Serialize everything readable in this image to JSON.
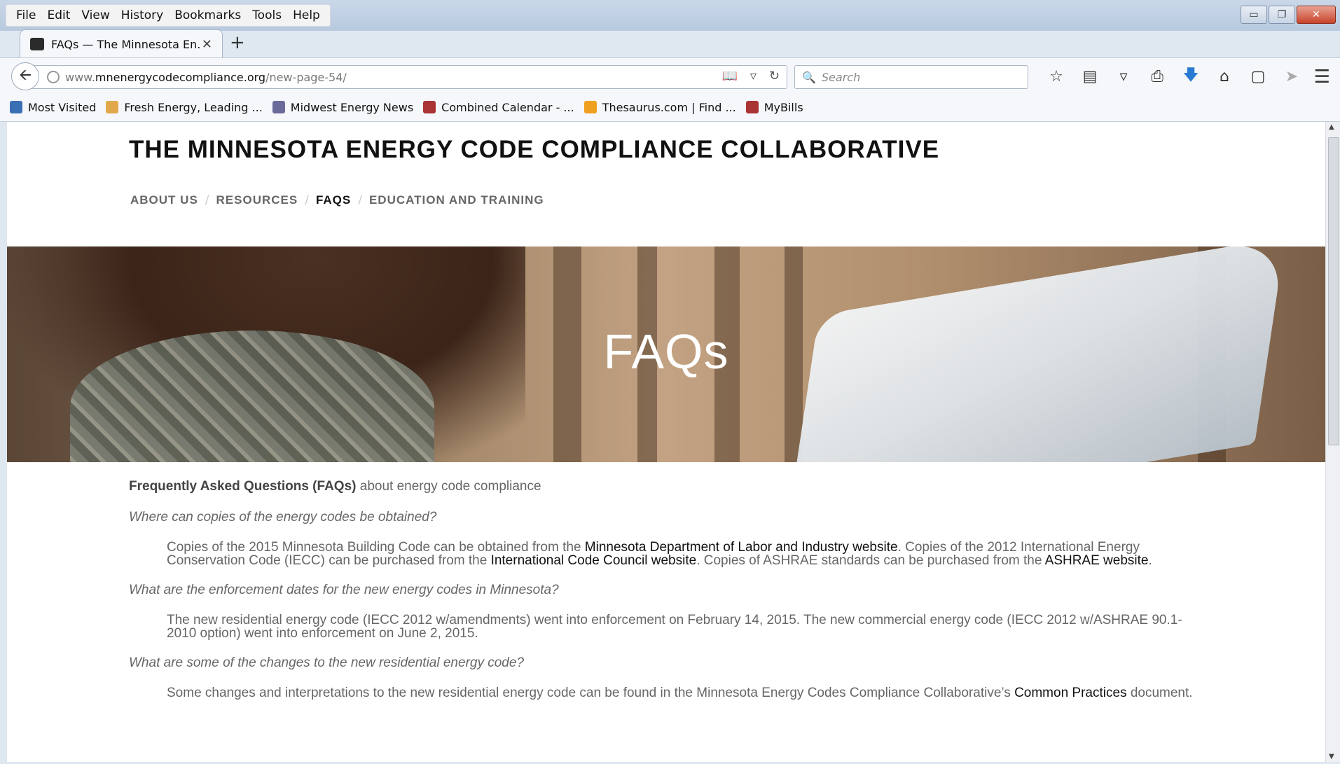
{
  "menu": [
    "File",
    "Edit",
    "View",
    "History",
    "Bookmarks",
    "Tools",
    "Help"
  ],
  "tab": {
    "title": "FAQs — The Minnesota En...",
    "close": "✕",
    "new_tab": "+"
  },
  "window_controls": {
    "minimize": "▭",
    "restore": "❐",
    "close": "✕"
  },
  "nav": {
    "url_prefix": "www.",
    "url_domain": "mnenergycodecompliance.org",
    "url_path": "/new-page-54/",
    "search_placeholder": "Search"
  },
  "bookmarks": [
    {
      "label": "Most Visited",
      "color": "#3a6fb5"
    },
    {
      "label": "Fresh Energy, Leading ...",
      "color": "#e0a84a"
    },
    {
      "label": "Midwest Energy News",
      "color": "#6a6a9a"
    },
    {
      "label": "Combined Calendar - ...",
      "color": "#a33"
    },
    {
      "label": "Thesaurus.com | Find ...",
      "color": "#f0a020"
    },
    {
      "label": "MyBills",
      "color": "#a33"
    }
  ],
  "site": {
    "title": "THE MINNESOTA ENERGY CODE COMPLIANCE COLLABORATIVE",
    "nav": [
      "ABOUT US",
      "RESOURCES",
      "FAQS",
      "EDUCATION AND TRAINING"
    ],
    "nav_sep": "/",
    "hero_title": "FAQs"
  },
  "content": {
    "intro_bold": "Frequently Asked Questions (FAQs)",
    "intro_rest": " about energy code compliance",
    "q1": "Where can copies of the energy codes be obtained?",
    "a1": {
      "t1": "Copies of the 2015 Minnesota Building Code can be obtained from the ",
      "l1": "Minnesota Department of Labor and Industry website",
      "t2": ". Copies of the 2012 International Energy Conservation Code (IECC) can be purchased from the ",
      "l2": "International Code Council website",
      "t3": ". Copies of ASHRAE standards can be purchased from the ",
      "l3": "ASHRAE website",
      "t4": "."
    },
    "q2": "What are the enforcement dates for the new energy codes in Minnesota?",
    "a2": "The new residential energy code (IECC 2012 w/amendments) went into enforcement on February 14, 2015. The new commercial energy code (IECC 2012 w/ASHRAE 90.1-2010 option) went into enforcement on June 2, 2015.",
    "q3": "What are some of the changes to the new residential energy code?",
    "a3": {
      "t1": "Some changes and interpretations to the new residential energy code can be found in the Minnesota Energy Codes Compliance Collaborative’s ",
      "l1": "Common Practices",
      "t2": " document."
    }
  }
}
